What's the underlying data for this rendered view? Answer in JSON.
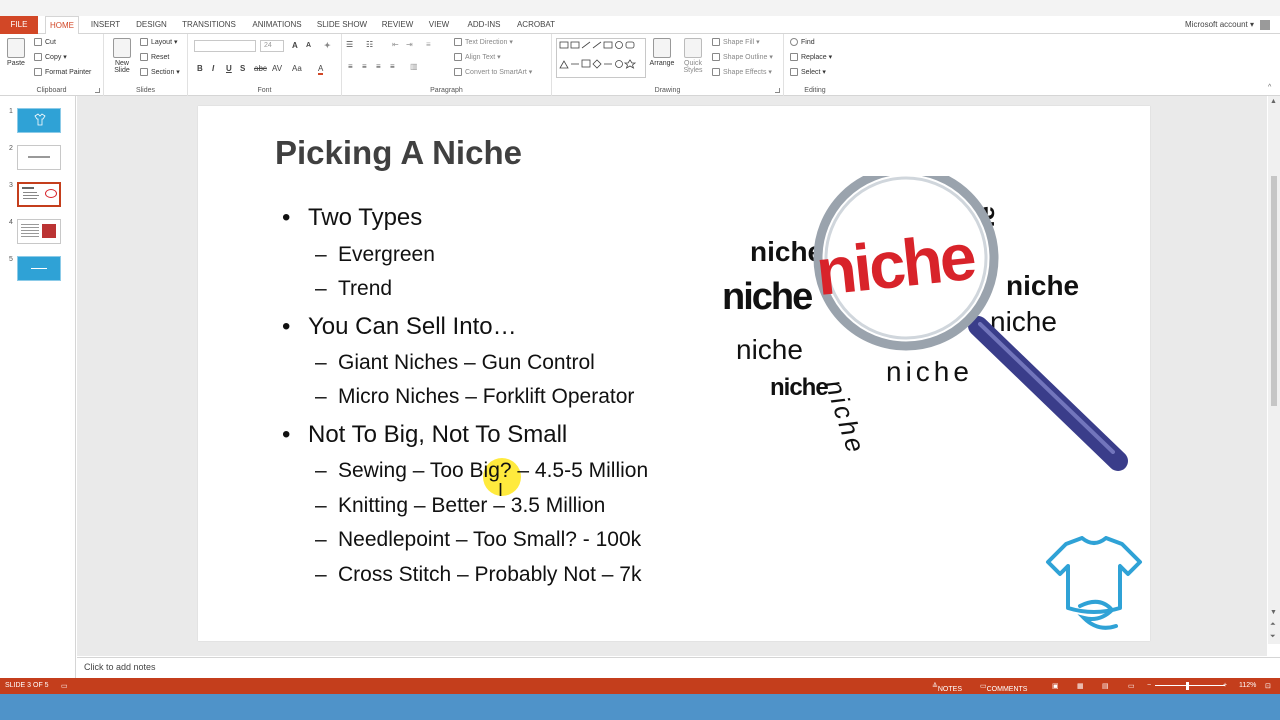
{
  "tabs": {
    "file": "FILE",
    "items": [
      "HOME",
      "INSERT",
      "DESIGN",
      "TRANSITIONS",
      "ANIMATIONS",
      "SLIDE SHOW",
      "REVIEW",
      "VIEW",
      "ADD-INS",
      "ACROBAT"
    ],
    "active": "HOME",
    "account": "Microsoft account"
  },
  "ribbon": {
    "clipboard": {
      "label": "Clipboard",
      "paste": "Paste",
      "cut": "Cut",
      "copy": "Copy",
      "format_painter": "Format Painter"
    },
    "slides": {
      "label": "Slides",
      "new_slide_1": "New",
      "new_slide_2": "Slide",
      "layout": "Layout",
      "reset": "Reset",
      "section": "Section"
    },
    "font": {
      "label": "Font",
      "size": "24"
    },
    "paragraph": {
      "label": "Paragraph",
      "text_direction": "Text Direction",
      "align_text": "Align Text",
      "convert_smartart": "Convert to SmartArt"
    },
    "drawing": {
      "label": "Drawing",
      "arrange": "Arrange",
      "quick_styles_1": "Quick",
      "quick_styles_2": "Styles",
      "shape_fill": "Shape Fill",
      "shape_outline": "Shape Outline",
      "shape_effects": "Shape Effects"
    },
    "editing": {
      "label": "Editing",
      "find": "Find",
      "replace": "Replace",
      "select": "Select"
    }
  },
  "thumbnails": [
    "1",
    "2",
    "3",
    "4",
    "5"
  ],
  "selected_slide": "3",
  "slide": {
    "title": "Picking A Niche",
    "bullets": [
      {
        "text": "Two Types",
        "subs": [
          "Evergreen",
          "Trend"
        ]
      },
      {
        "text": "You Can Sell Into…",
        "subs": [
          "Giant Niches – Gun Control",
          "Micro Niches – Forklift Operator"
        ]
      },
      {
        "text": "Not To Big, Not To Small",
        "subs": [
          "Sewing – Too Big? – 4.5-5 Million",
          "Knitting – Better – 3.5 Million",
          "Needlepoint – Too Small? - 100k",
          "Cross Stitch – Probably Not – 7k"
        ]
      }
    ],
    "bullet_glyph": "•",
    "dash_glyph": "–",
    "niche_words": [
      "niche",
      "niche",
      "niche",
      "niche",
      "niche",
      "niche",
      "niche",
      "niche",
      "niche",
      "niche"
    ],
    "center_word": "niche"
  },
  "notes": {
    "placeholder": "Click to add notes"
  },
  "status": {
    "slide_of": "SLIDE 3 OF 5",
    "notes": "NOTES",
    "comments": "COMMENTS",
    "zoom": "112%"
  },
  "colors": {
    "accent": "#c43e1c",
    "file_tab": "#d24726",
    "thumb_blue": "#2fa2d6",
    "niche_red": "#d8232a",
    "handle_blue": "#3a3d8a"
  }
}
